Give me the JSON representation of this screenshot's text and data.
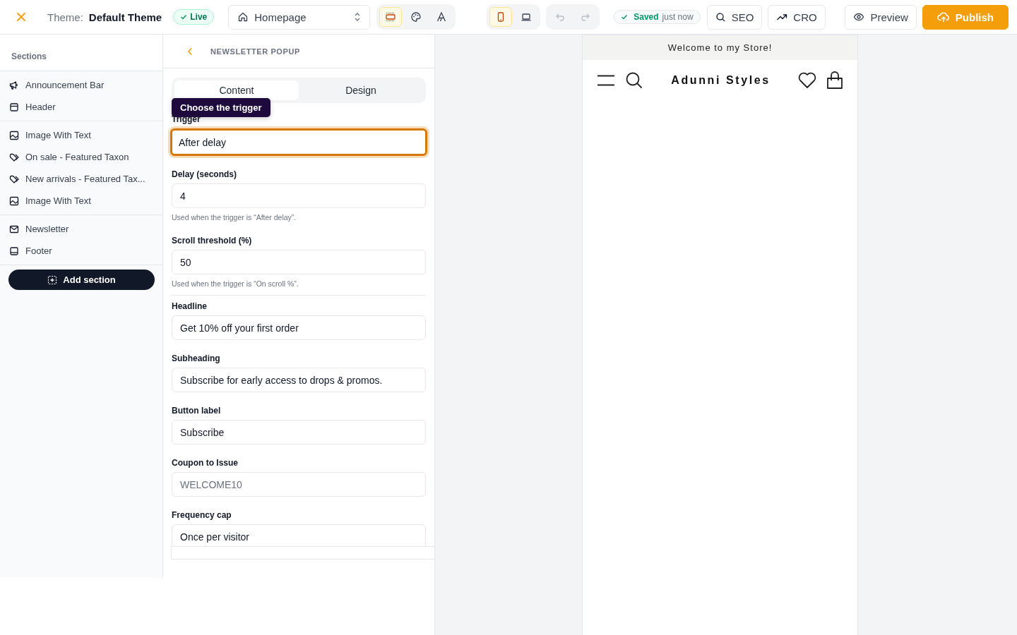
{
  "topbar": {
    "theme_label": "Theme:",
    "theme_name": "Default Theme",
    "status_badge": "Live",
    "page_select": "Homepage",
    "modes": [
      {
        "kind": "sections",
        "selected": true
      },
      {
        "kind": "palette",
        "selected": false
      },
      {
        "kind": "typography",
        "selected": false
      }
    ],
    "viewports": [
      {
        "kind": "mobile",
        "selected": true
      },
      {
        "kind": "desktop",
        "selected": false
      }
    ],
    "history": [
      {
        "kind": "undo",
        "disabled": true
      },
      {
        "kind": "redo",
        "disabled": true
      }
    ],
    "save_status": {
      "label": "Saved",
      "time": "just now"
    },
    "buttons": [
      {
        "kind": "seo",
        "label": "SEO"
      },
      {
        "kind": "cro",
        "label": "CRO"
      },
      {
        "kind": "preview",
        "label": "Preview"
      },
      {
        "kind": "publish",
        "label": "Publish"
      }
    ]
  },
  "sidebar": {
    "title": "Sections",
    "groups": [
      [
        {
          "kind": "megaphone",
          "label": "Announcement Bar"
        },
        {
          "kind": "header",
          "label": "Header"
        }
      ],
      [
        {
          "kind": "image",
          "label": "Image With Text"
        },
        {
          "kind": "tag",
          "label": "On sale - Featured Taxon"
        },
        {
          "kind": "tag",
          "label": "New arrivals - Featured Tax..."
        },
        {
          "kind": "image",
          "label": "Image With Text"
        }
      ],
      [
        {
          "kind": "mail",
          "label": "Newsletter"
        },
        {
          "kind": "footer",
          "label": "Footer"
        }
      ]
    ],
    "add_button": "Add section"
  },
  "editor": {
    "title": "NEWSLETTER POPUP",
    "tabs": [
      {
        "label": "Content",
        "selected": true
      },
      {
        "label": "Design",
        "selected": false
      }
    ],
    "tooltip": "Choose the trigger",
    "fields": [
      {
        "label": "Trigger",
        "value": "After delay",
        "focused": true
      },
      {
        "label": "Delay (seconds)",
        "value": "4",
        "help": "Used when the trigger is “After delay”.",
        "focused": false
      },
      {
        "label": "Scroll threshold (%)",
        "value": "50",
        "help": "Used when the trigger is “On scroll %”.",
        "focused": false
      },
      {
        "label": "Headline",
        "value": "Get 10% off your first order",
        "divider_before": true,
        "focused": false
      },
      {
        "label": "Subheading",
        "value": "Subscribe for early access to drops & promos.",
        "focused": false
      },
      {
        "label": "Button label",
        "value": "Subscribe",
        "focused": false
      },
      {
        "label": "Coupon to Issue",
        "placeholder": "WELCOME10",
        "focused": false
      },
      {
        "label": "Frequency cap",
        "value": "Once per visitor",
        "focused": false
      }
    ]
  },
  "preview": {
    "announcement": "Welcome to my Store!",
    "brand": "Adunni Styles"
  }
}
